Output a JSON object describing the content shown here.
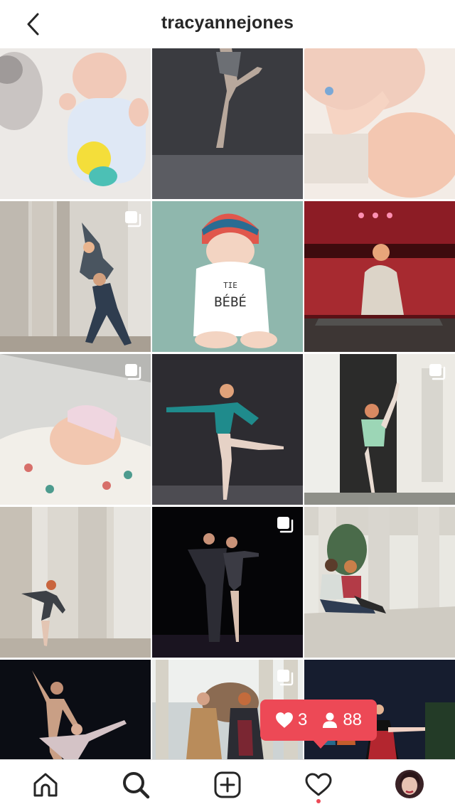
{
  "header": {
    "username": "tracyannejones",
    "back_icon": "chevron-left-icon"
  },
  "grid": {
    "tiles": [
      {
        "subject": "newborn with duck shirt",
        "multi": false
      },
      {
        "subject": "ballet dancer legs",
        "multi": false
      },
      {
        "subject": "mother kissing baby feet",
        "multi": false
      },
      {
        "subject": "partner lift among columns",
        "multi": true
      },
      {
        "subject": "baby with knit hat",
        "multi": false,
        "shirt_text": "TIE\nBÉBÉ"
      },
      {
        "subject": "dancer split on stage",
        "multi": false
      },
      {
        "subject": "newborn in hospital blanket",
        "multi": true
      },
      {
        "subject": "dancer in teal leotard",
        "multi": false
      },
      {
        "subject": "dancer by house",
        "multi": true
      },
      {
        "subject": "dancer among columns",
        "multi": false
      },
      {
        "subject": "couple dancing on dark stage",
        "multi": true
      },
      {
        "subject": "couple on steps",
        "multi": false
      },
      {
        "subject": "pas de deux dark",
        "multi": false
      },
      {
        "subject": "couple walking",
        "multi": true
      },
      {
        "subject": "stage performance",
        "multi": false
      }
    ]
  },
  "notification": {
    "likes": "3",
    "followers": "88",
    "like_icon": "heart-icon",
    "follower_icon": "person-icon"
  },
  "tabbar": {
    "items": [
      "home-icon",
      "search-icon",
      "add-post-icon",
      "activity-heart-icon",
      "profile-avatar"
    ]
  },
  "colors": {
    "accent": "#ed4956",
    "text": "#262626"
  }
}
